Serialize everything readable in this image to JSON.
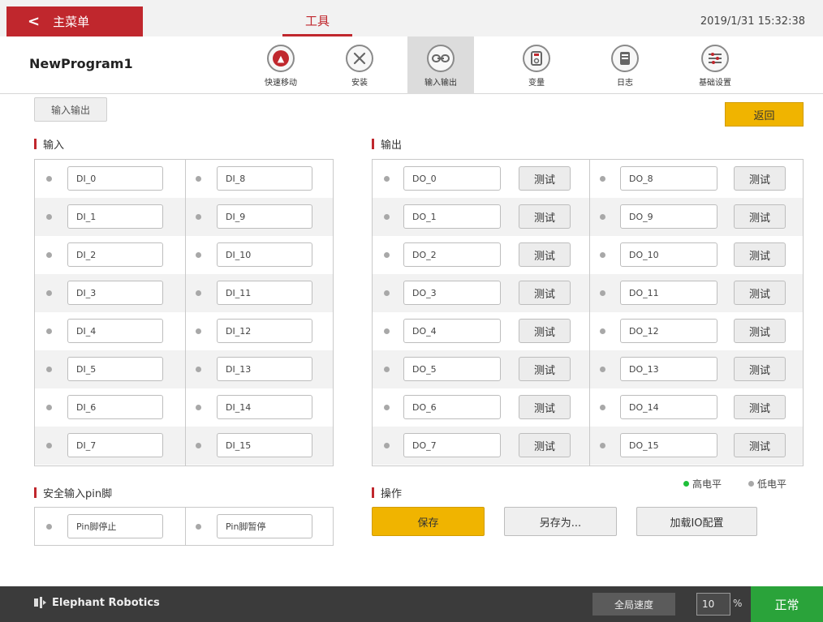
{
  "header": {
    "back_label": "主菜单",
    "active_tab": "工具",
    "datetime": "2019/1/31 15:32:38"
  },
  "program": {
    "name": "NewProgram1"
  },
  "tools": [
    {
      "label": "快速移动",
      "icon": "quick-move-icon"
    },
    {
      "label": "安装",
      "icon": "install-icon"
    },
    {
      "label": "输入输出",
      "icon": "io-icon"
    },
    {
      "label": "变量",
      "icon": "variable-icon"
    },
    {
      "label": "日志",
      "icon": "log-icon"
    },
    {
      "label": "基础设置",
      "icon": "settings-icon"
    }
  ],
  "subtab": {
    "label": "输入输出"
  },
  "return_label": "返回",
  "inputs": {
    "title": "输入",
    "left": [
      "DI_0",
      "DI_1",
      "DI_2",
      "DI_3",
      "DI_4",
      "DI_5",
      "DI_6",
      "DI_7"
    ],
    "right": [
      "DI_8",
      "DI_9",
      "DI_10",
      "DI_11",
      "DI_12",
      "DI_13",
      "DI_14",
      "DI_15"
    ]
  },
  "outputs": {
    "title": "输出",
    "test_label": "测试",
    "left": [
      "DO_0",
      "DO_1",
      "DO_2",
      "DO_3",
      "DO_4",
      "DO_5",
      "DO_6",
      "DO_7"
    ],
    "right": [
      "DO_8",
      "DO_9",
      "DO_10",
      "DO_11",
      "DO_12",
      "DO_13",
      "DO_14",
      "DO_15"
    ]
  },
  "safety": {
    "title": "安全输入pin脚",
    "items": [
      "Pin脚停止",
      "Pin脚暂停"
    ]
  },
  "legend": {
    "high": "高电平",
    "low": "低电平",
    "high_color": "#1fbf3a",
    "low_color": "#a8a8a8"
  },
  "operations": {
    "title": "操作",
    "save": "保存",
    "save_as": "另存为...",
    "load": "加载IO配置"
  },
  "footer": {
    "brand": "Elephant Robotics",
    "speed_label": "全局速度",
    "speed_value": "10",
    "speed_unit": "%",
    "status": "正常"
  },
  "colors": {
    "accent": "#c0272d",
    "primary_button": "#f0b400",
    "status_ok": "#2aa33a"
  }
}
